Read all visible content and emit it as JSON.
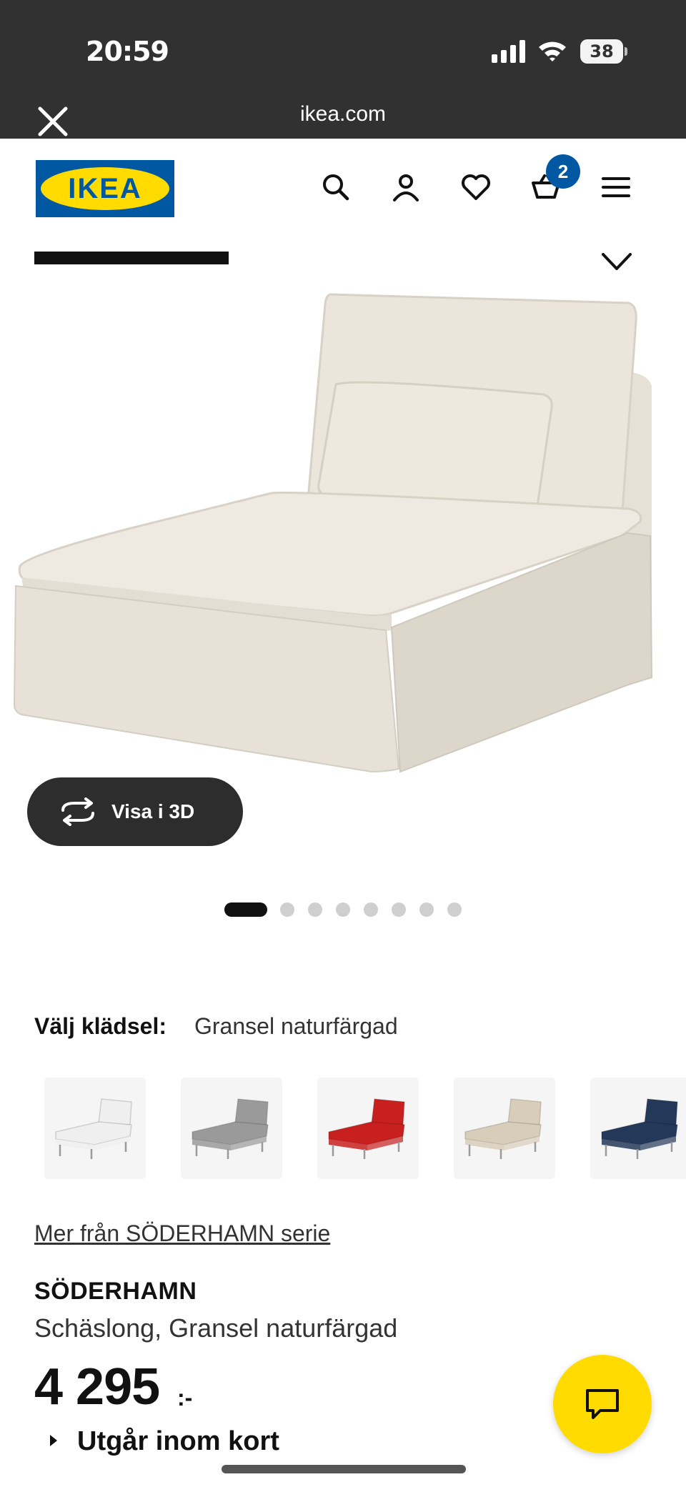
{
  "status_bar": {
    "time": "20:59",
    "battery_level": "38"
  },
  "browser": {
    "url": "ikea.com",
    "close_icon": "close-icon"
  },
  "header": {
    "logo_text": "IKEA",
    "icons": [
      "search-icon",
      "profile-icon",
      "heart-icon",
      "cart-icon",
      "menu-icon"
    ],
    "cart_count": "2"
  },
  "gallery": {
    "view_3d_label": "Visa i 3D",
    "total_images": 8,
    "active_image_index": 0
  },
  "options": {
    "label": "Välj klädsel:",
    "selected_value": "Gransel naturfärgad",
    "swatches": [
      {
        "color": "#efefef"
      },
      {
        "color": "#9a9a9a"
      },
      {
        "color": "#c8201f"
      },
      {
        "color": "#d8cdb9"
      },
      {
        "color": "#24385a"
      }
    ]
  },
  "product": {
    "series_link": "Mer från SÖDERHAMN serie",
    "name": "SÖDERHAMN",
    "description": "Schäslong, Gransel naturfärgad",
    "price": "4 295",
    "price_suffix": ":-",
    "status": "Utgår inom kort"
  },
  "colors": {
    "ikea_blue": "#0058a3",
    "ikea_yellow": "#ffdb00"
  }
}
